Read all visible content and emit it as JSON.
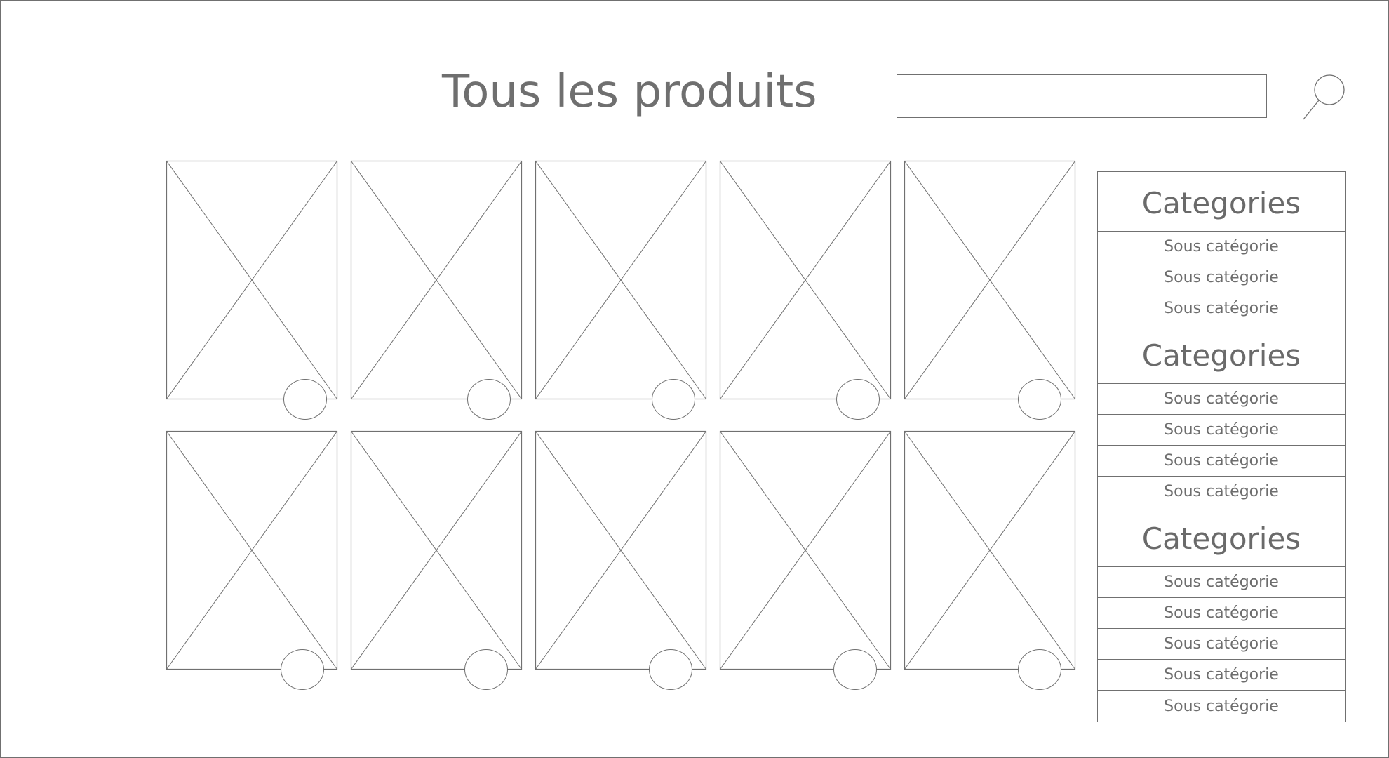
{
  "page": {
    "title": "Tous les produits"
  },
  "search": {
    "value": "",
    "placeholder": "",
    "icon": "search-icon"
  },
  "products": {
    "count_per_row": 5,
    "rows": 2,
    "image_icon": "image-placeholder-icon",
    "badge_shape": "circle"
  },
  "sidebar": {
    "groups": [
      {
        "title": "Categories",
        "items": [
          "Sous catégorie",
          "Sous catégorie",
          "Sous catégorie"
        ]
      },
      {
        "title": "Categories",
        "items": [
          "Sous catégorie",
          "Sous catégorie",
          "Sous catégorie",
          "Sous catégorie"
        ]
      },
      {
        "title": "Categories",
        "items": [
          "Sous catégorie",
          "Sous catégorie",
          "Sous catégorie",
          "Sous catégorie",
          "Sous catégorie"
        ]
      }
    ]
  },
  "colors": {
    "line": "#707070",
    "text": "#6f6f6f",
    "background": "#ffffff"
  }
}
